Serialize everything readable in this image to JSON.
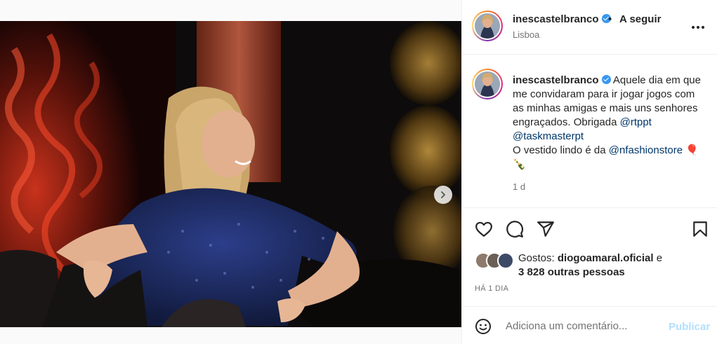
{
  "post": {
    "username": "inescastelbranco",
    "verified": true,
    "follow_label": "A seguir",
    "separator": "•",
    "location": "Lisboa",
    "caption_lines": {
      "l1": "Aquele dia em que",
      "l2": "me convidaram para ir jogar jogos com",
      "l3": "as minhas amigas e mais uns senhores",
      "l4": "engraçados. Obrigada ",
      "mention1": "@rtppt",
      "mention2": "@taskmasterpt",
      "l6": "O vestido lindo é da ",
      "mention3": "@nfashionstore",
      "emoji1": "🎈",
      "emoji2": "🍾"
    },
    "caption_time": "1 d",
    "likes_prefix": "Gostos: ",
    "liked_by": "diogoamaral.oficial",
    "likes_joiner": " e",
    "likes_others": "3 828 outras pessoas",
    "posted_ago": "HÁ 1 DIA",
    "carousel": {
      "total_slides": 6,
      "active_index": 0
    }
  },
  "comment": {
    "placeholder": "Adiciona um comentário...",
    "publish_label": "Publicar"
  },
  "icons": {
    "heart": "heart-icon",
    "comment": "comment-icon",
    "share": "share-icon",
    "save": "bookmark-icon",
    "more": "more-options-icon",
    "emoji": "emoji-icon",
    "next": "chevron-right-icon"
  },
  "colors": {
    "accent": "#0095f6",
    "verified": "#3897f0",
    "mention": "#00376b",
    "publish_disabled": "#b2dffc"
  }
}
